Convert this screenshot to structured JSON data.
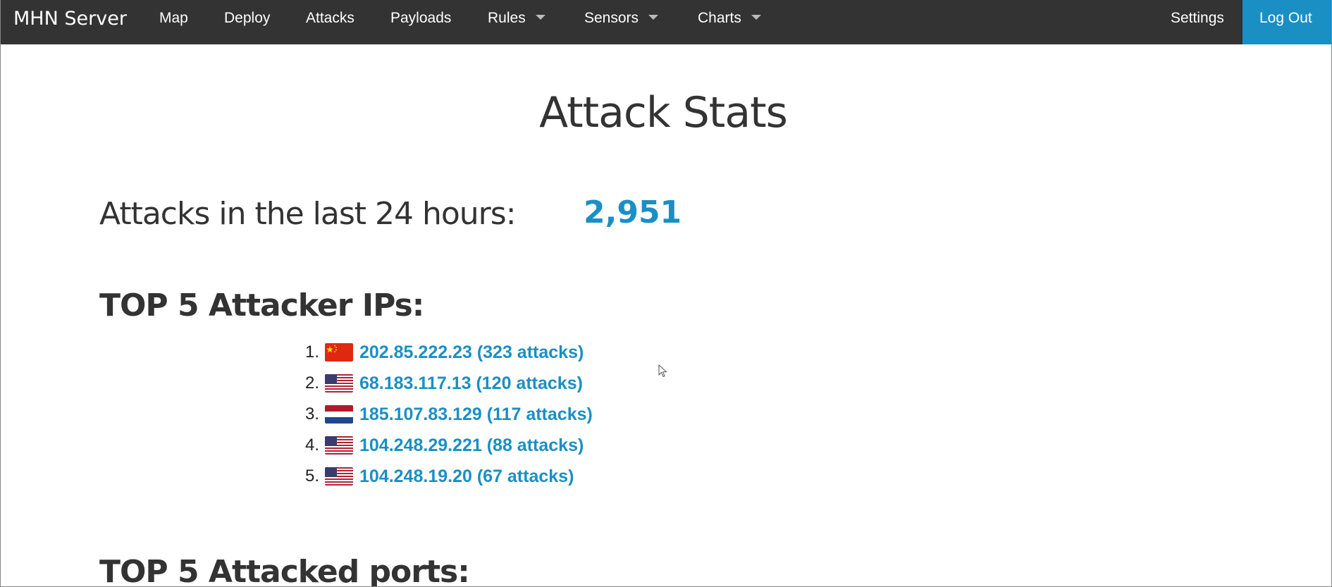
{
  "navbar": {
    "brand": "MHN Server",
    "items": [
      {
        "label": "Map"
      },
      {
        "label": "Deploy"
      },
      {
        "label": "Attacks"
      },
      {
        "label": "Payloads"
      },
      {
        "label": "Rules"
      },
      {
        "label": "Sensors"
      },
      {
        "label": "Charts"
      }
    ],
    "settings": "Settings",
    "logout": "Log Out"
  },
  "page": {
    "title": "Attack Stats",
    "attacks_label": "Attacks in the last 24 hours:",
    "attacks_value": "2,951",
    "top_ips_heading": "TOP 5 Attacker IPs:",
    "top_ports_heading": "TOP 5 Attacked ports:"
  },
  "top_ips": [
    {
      "rank": "1.",
      "flag": "china-flag-icon",
      "text": "202.85.222.23 (323 attacks)"
    },
    {
      "rank": "2.",
      "flag": "usa-flag-icon",
      "text": "68.183.117.13 (120 attacks)"
    },
    {
      "rank": "3.",
      "flag": "netherlands-flag-icon",
      "text": "185.107.83.129 (117 attacks)"
    },
    {
      "rank": "4.",
      "flag": "usa-flag-icon",
      "text": "104.248.29.221 (88 attacks)"
    },
    {
      "rank": "5.",
      "flag": "usa-flag-icon",
      "text": "104.248.19.20 (67 attacks)"
    }
  ],
  "colors": {
    "navbar_bg": "#333333",
    "accent": "#1a8fc4",
    "text": "#333333"
  }
}
